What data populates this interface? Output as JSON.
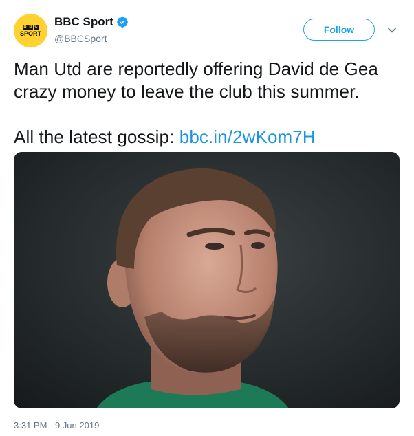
{
  "account": {
    "display_name": "BBC Sport",
    "handle": "@BBCSport",
    "verified": true,
    "avatar": {
      "logo_text_top": [
        "B",
        "B",
        "C"
      ],
      "logo_text_bottom": "SPORT",
      "bg_color": "#ffd230"
    }
  },
  "actions": {
    "follow_label": "Follow",
    "menu_icon": "chevron-down-icon"
  },
  "tweet": {
    "line1": "Man Utd are reportedly offering David de Gea crazy money to leave the club this summer.",
    "gossip_prefix": "All the latest gossip: ",
    "link_text": "bbc.in/2wKom7H",
    "timestamp": "3:31 PM - 9 Jun 2019"
  },
  "colors": {
    "accent": "#1da1f2",
    "link": "#1b95e0",
    "muted": "#657786",
    "text": "#14171a"
  }
}
